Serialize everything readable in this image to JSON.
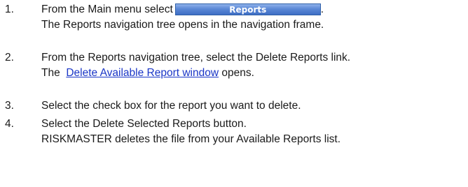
{
  "steps": [
    {
      "number": "1.",
      "text_before_button": "From the Main menu select",
      "button_label": "Reports",
      "text_after_button": ".",
      "result": "The Reports navigation tree opens in the navigation frame."
    },
    {
      "number": "2.",
      "text": "From the Reports navigation tree, select the Delete Reports link.",
      "result_prefix": "The",
      "result_link": "Delete Available Report window",
      "result_suffix": "opens."
    },
    {
      "number": "3.",
      "text": "Select the check box for the report you want to delete."
    },
    {
      "number": "4.",
      "text": "Select the Delete Selected Reports button.",
      "result": "RISKMASTER deletes the file from your Available Reports list."
    }
  ],
  "colors": {
    "text": "#1a1a1a",
    "link": "#1a36c7",
    "button_top": "#8fb2ea",
    "button_bottom": "#3e6ec4"
  }
}
